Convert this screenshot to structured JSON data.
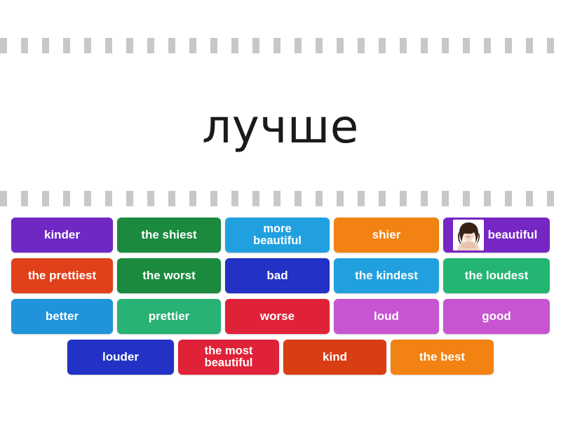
{
  "prompt": {
    "word": "лучше",
    "language": "Russian"
  },
  "separator": {
    "dash_color": "#c8c8c8",
    "dash_count": 27,
    "dash_width": 10,
    "dash_gap": 20
  },
  "board": {
    "rows": [
      {
        "tiles": [
          {
            "label": "kinder",
            "color": "#6f28c4",
            "lines": 1,
            "width": "w-145"
          },
          {
            "label": "the shiest",
            "color": "#1b8a3e",
            "lines": 1,
            "width": "w-148"
          },
          {
            "label": "more\nbeautiful",
            "color": "#21a0e0",
            "lines": 2,
            "width": "w-149"
          },
          {
            "label": "shier",
            "color": "#f28211",
            "lines": 1,
            "width": "w-150"
          },
          {
            "label": "beautiful",
            "color": "#7526c3",
            "lines": 1,
            "width": "w-152",
            "image": "woman-portrait"
          }
        ]
      },
      {
        "tiles": [
          {
            "label": "the prettiest",
            "color": "#e0401a",
            "lines": 1,
            "width": "w-145"
          },
          {
            "label": "the worst",
            "color": "#1b8a3e",
            "lines": 1,
            "width": "w-148"
          },
          {
            "label": "bad",
            "color": "#2132c4",
            "lines": 1,
            "width": "w-149"
          },
          {
            "label": "the kindest",
            "color": "#21a0e0",
            "lines": 1,
            "width": "w-150"
          },
          {
            "label": "the loudest",
            "color": "#24b573",
            "lines": 1,
            "width": "w-152"
          }
        ]
      },
      {
        "tiles": [
          {
            "label": "better",
            "color": "#1f94da",
            "lines": 1,
            "width": "w-145"
          },
          {
            "label": "prettier",
            "color": "#28b273",
            "lines": 1,
            "width": "w-148"
          },
          {
            "label": "worse",
            "color": "#e02238",
            "lines": 1,
            "width": "w-149"
          },
          {
            "label": "loud",
            "color": "#c755d2",
            "lines": 1,
            "width": "w-150"
          },
          {
            "label": "good",
            "color": "#c755d2",
            "lines": 1,
            "width": "w-152"
          }
        ]
      },
      {
        "tiles": [
          {
            "label": "louder",
            "color": "#2132c4",
            "lines": 1,
            "width": "w-152"
          },
          {
            "label": "the most\nbeautiful",
            "color": "#e02238",
            "lines": 2,
            "width": "w-144"
          },
          {
            "label": "kind",
            "color": "#d93d13",
            "lines": 1,
            "width": "w-147"
          },
          {
            "label": "the best",
            "color": "#f28211",
            "lines": 1,
            "width": "w-147"
          }
        ]
      }
    ]
  }
}
